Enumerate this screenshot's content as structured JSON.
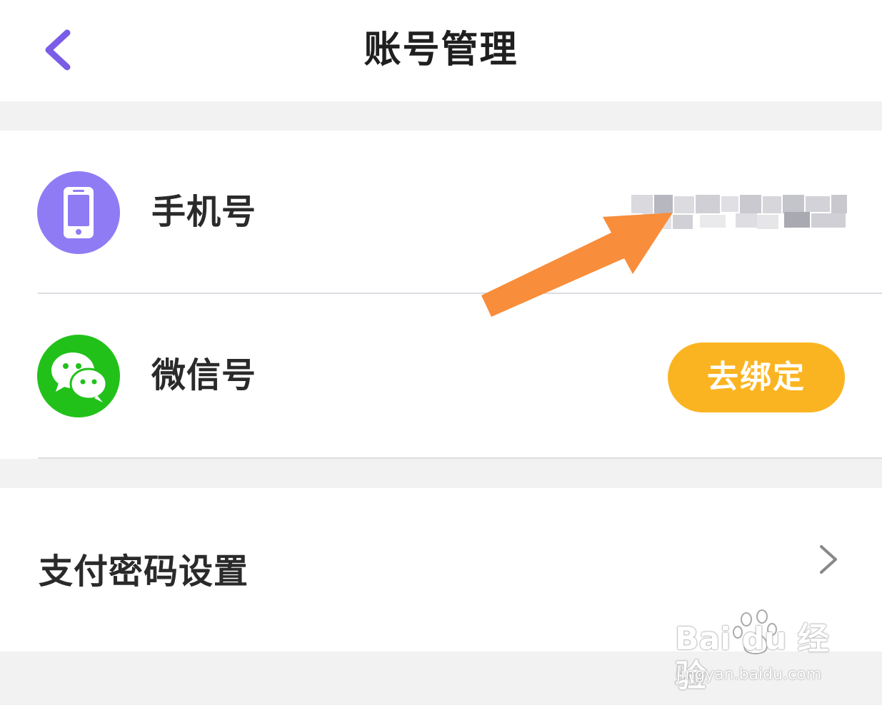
{
  "header": {
    "title": "账号管理"
  },
  "account_rows": [
    {
      "label": "手机号"
    },
    {
      "label": "微信号",
      "action_label": "去绑定"
    }
  ],
  "payment": {
    "label": "支付密码设置"
  },
  "watermark": {
    "logo": "Bai du 经验",
    "url": "jingyan.baidu.com"
  },
  "colors": {
    "back_arrow": "#7b5ce6",
    "phone_icon_bg": "#8f7cf5",
    "wechat_icon_bg": "#22c11a",
    "bind_button_bg": "#fbb421",
    "annotation_arrow": "#f88d3b",
    "divider": "#dcdce2",
    "page_bg": "#f2f2f2"
  },
  "icons": {
    "back": "chevron-left-icon",
    "phone": "mobile-phone-icon",
    "wechat": "wechat-icon",
    "row_chevron": "chevron-right-icon"
  }
}
